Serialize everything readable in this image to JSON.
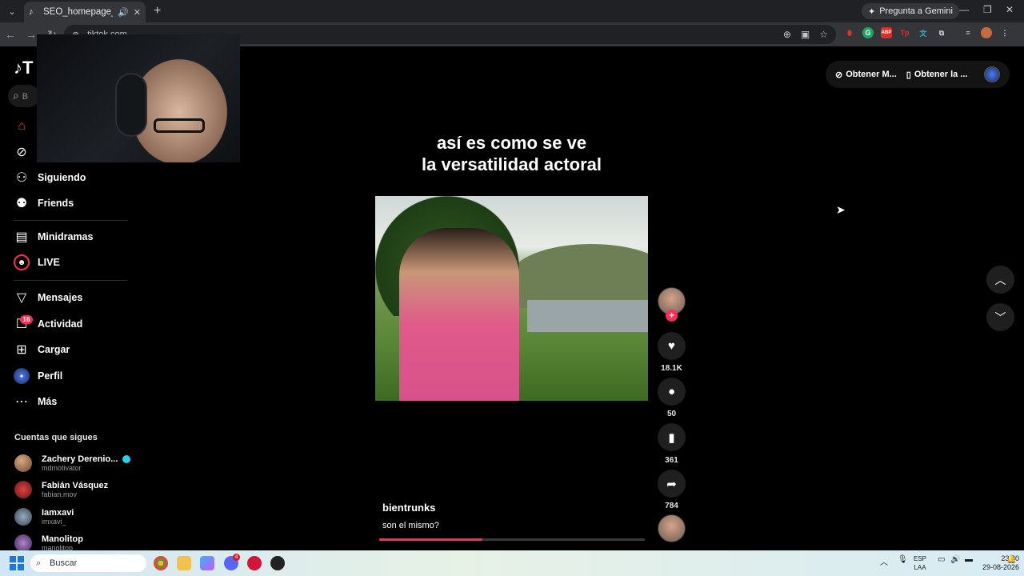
{
  "browser": {
    "tab_title": "SEO_homepage_title",
    "url": "tiktok.com",
    "gemini_label": "Pregunta a Gemini"
  },
  "tiktok": {
    "logo": "T",
    "search_letter": "B",
    "nav": [
      {
        "label": "",
        "icon": "home-icon"
      },
      {
        "label": "",
        "icon": "explore-icon"
      },
      {
        "label": "Siguiendo",
        "icon": "following-icon"
      },
      {
        "label": "Friends",
        "icon": "friends-icon"
      },
      {
        "label": "Minidramas",
        "icon": "minidramas-icon"
      },
      {
        "label": "LIVE",
        "icon": "live-icon"
      },
      {
        "label": "Mensajes",
        "icon": "messages-icon"
      },
      {
        "label": "Actividad",
        "icon": "activity-icon"
      },
      {
        "label": "Cargar",
        "icon": "upload-icon"
      },
      {
        "label": "Perfil",
        "icon": "profile-icon"
      },
      {
        "label": "Más",
        "icon": "more-icon"
      }
    ],
    "activity_badge": "16",
    "following_header": "Cuentas que sigues",
    "accounts": [
      {
        "name": "Zachery Derenio...",
        "handle": "mdmotivator"
      },
      {
        "name": "Fabián Vásquez",
        "handle": "fabian.mov"
      },
      {
        "name": "Iamxavi",
        "handle": "imxavi_"
      },
      {
        "name": "Manolitop",
        "handle": "manolitop"
      }
    ],
    "top_actions": {
      "get_coins": "Obtener M...",
      "get_app": "Obtener la ..."
    },
    "video": {
      "caption_line1": "así es como se ve",
      "caption_line2": "la versatilidad actoral",
      "author": "bientrunks",
      "description": "son el mismo?",
      "likes": "18.1K",
      "comments": "50",
      "saves": "361",
      "shares": "784",
      "progress_fraction": 0.39
    }
  },
  "taskbar": {
    "search_placeholder": "Buscar",
    "lang_line1": "ESP",
    "lang_line2": "LAA",
    "time": "23:30",
    "date": "29-08-2026",
    "discord_badge": "4"
  },
  "colors": {
    "accent": "#fe2c55",
    "verified": "#20d5ec"
  }
}
